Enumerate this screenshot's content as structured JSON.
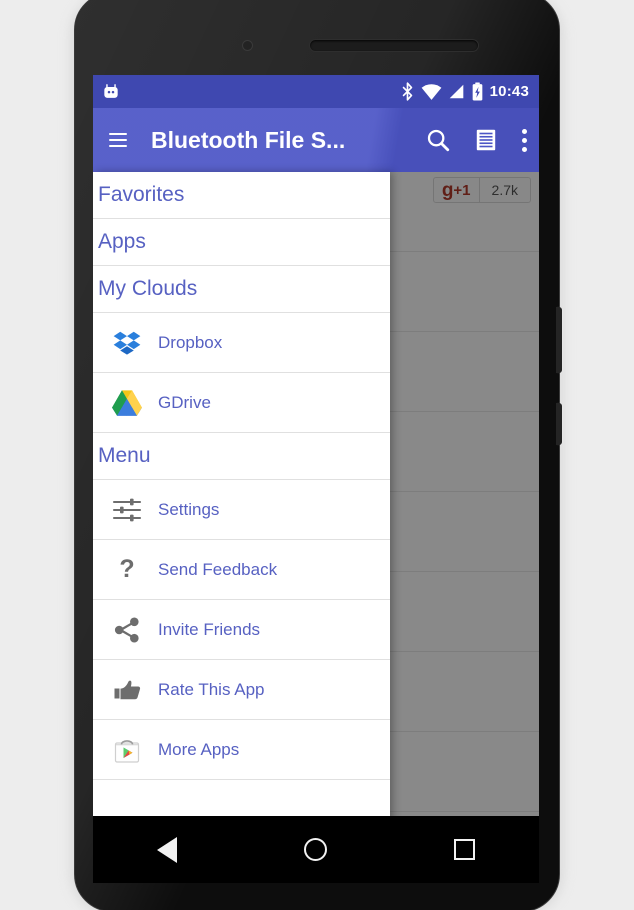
{
  "statusbar": {
    "notification_icon": "android-robot-icon",
    "icons": [
      "bluetooth-icon",
      "wifi-icon",
      "cell-signal-icon",
      "battery-charging-icon"
    ],
    "clock": "10:43"
  },
  "toolbar": {
    "menu_icon": "hamburger-menu-icon",
    "title": "Bluetooth File S...",
    "actions": [
      {
        "name": "search-icon",
        "label": "Search"
      },
      {
        "name": "list-view-icon",
        "label": "List"
      },
      {
        "name": "overflow-menu-icon",
        "label": "More options"
      }
    ],
    "background_color": "#4c55c6"
  },
  "background_content": {
    "plus_one": {
      "label_g": "g",
      "label_plus": "+1",
      "count": "2.7k"
    },
    "row_count": 8,
    "scrim_color": "rgba(0,0,0,0.45)"
  },
  "drawer": {
    "text_color": "#5761c2",
    "sections": [
      {
        "type": "header",
        "name": "drawer-header-favorites",
        "label": "Favorites"
      },
      {
        "type": "header",
        "name": "drawer-header-apps",
        "label": "Apps"
      },
      {
        "type": "header",
        "name": "drawer-header-my-clouds",
        "label": "My Clouds"
      },
      {
        "type": "item",
        "name": "drawer-item-dropbox",
        "label": "Dropbox",
        "icon": "dropbox-icon"
      },
      {
        "type": "item",
        "name": "drawer-item-gdrive",
        "label": "GDrive",
        "icon": "google-drive-icon"
      },
      {
        "type": "header",
        "name": "drawer-header-menu",
        "label": "Menu"
      },
      {
        "type": "item",
        "name": "drawer-item-settings",
        "label": "Settings",
        "icon": "sliders-settings-icon"
      },
      {
        "type": "item",
        "name": "drawer-item-send-feedback",
        "label": "Send Feedback",
        "icon": "question-mark-icon"
      },
      {
        "type": "item",
        "name": "drawer-item-invite-friends",
        "label": "Invite Friends",
        "icon": "share-icon"
      },
      {
        "type": "item",
        "name": "drawer-item-rate-this-app",
        "label": "Rate This App",
        "icon": "thumbs-up-icon"
      },
      {
        "type": "item",
        "name": "drawer-item-more-apps",
        "label": "More Apps",
        "icon": "play-store-bag-icon"
      }
    ]
  },
  "navbar": {
    "back_label": "Back",
    "home_label": "Home",
    "recent_label": "Recent apps"
  }
}
